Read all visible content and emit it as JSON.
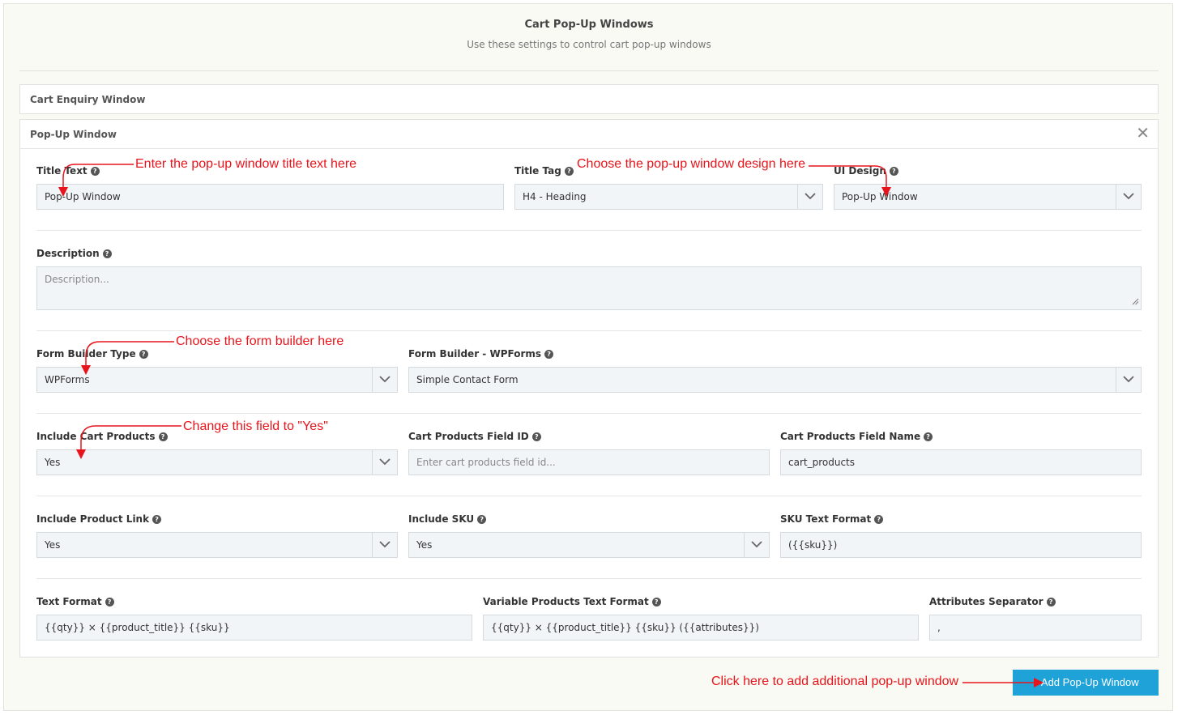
{
  "header": {
    "title": "Cart Pop-Up Windows",
    "subtitle": "Use these settings to control cart pop-up windows"
  },
  "panels": {
    "cart_enquiry": {
      "title": "Cart Enquiry Window"
    },
    "popup": {
      "title": "Pop-Up Window",
      "close_glyph": "✕"
    }
  },
  "help_glyph": "?",
  "fields": {
    "title_text": {
      "label": "Title Text",
      "value": "Pop-Up Window"
    },
    "title_tag": {
      "label": "Title Tag",
      "value": "H4 - Heading"
    },
    "ui_design": {
      "label": "UI Design",
      "value": "Pop-Up Window"
    },
    "description": {
      "label": "Description",
      "placeholder": "Description..."
    },
    "form_builder_type": {
      "label": "Form Builder Type",
      "value": "WPForms"
    },
    "form_builder_wpforms": {
      "label": "Form Builder - WPForms",
      "value": "Simple Contact Form"
    },
    "include_cart_products": {
      "label": "Include Cart Products",
      "value": "Yes"
    },
    "cart_products_field_id": {
      "label": "Cart Products Field ID",
      "placeholder": "Enter cart products field id..."
    },
    "cart_products_field_name": {
      "label": "Cart Products Field Name",
      "value": "cart_products"
    },
    "include_product_link": {
      "label": "Include Product Link",
      "value": "Yes"
    },
    "include_sku": {
      "label": "Include SKU",
      "value": "Yes"
    },
    "sku_text_format": {
      "label": "SKU Text Format",
      "value": "({{sku}})"
    },
    "text_format": {
      "label": "Text Format",
      "value": "{{qty}} × {{product_title}} {{sku}}"
    },
    "variable_products_text_format": {
      "label": "Variable Products Text Format",
      "value": "{{qty}} × {{product_title}} {{sku}} ({{attributes}})"
    },
    "attributes_separator": {
      "label": "Attributes Separator",
      "value": ","
    }
  },
  "annotations": {
    "title_text": "Enter the pop-up window title text here",
    "ui_design": "Choose the pop-up window design here",
    "form_builder": "Choose the form builder here",
    "cart_products": "Change this field to \"Yes\"",
    "add_window": "Click here to add additional pop-up window"
  },
  "add_button": {
    "label": "+ Add Pop-Up Window"
  },
  "colors": {
    "accent": "#1ea2d8",
    "annotation": "#e8141b",
    "field_bg": "#f1f5f7"
  },
  "icons": [
    "help-icon",
    "close-icon",
    "chevron-down-icon",
    "resize-grip-icon",
    "plus-icon"
  ]
}
